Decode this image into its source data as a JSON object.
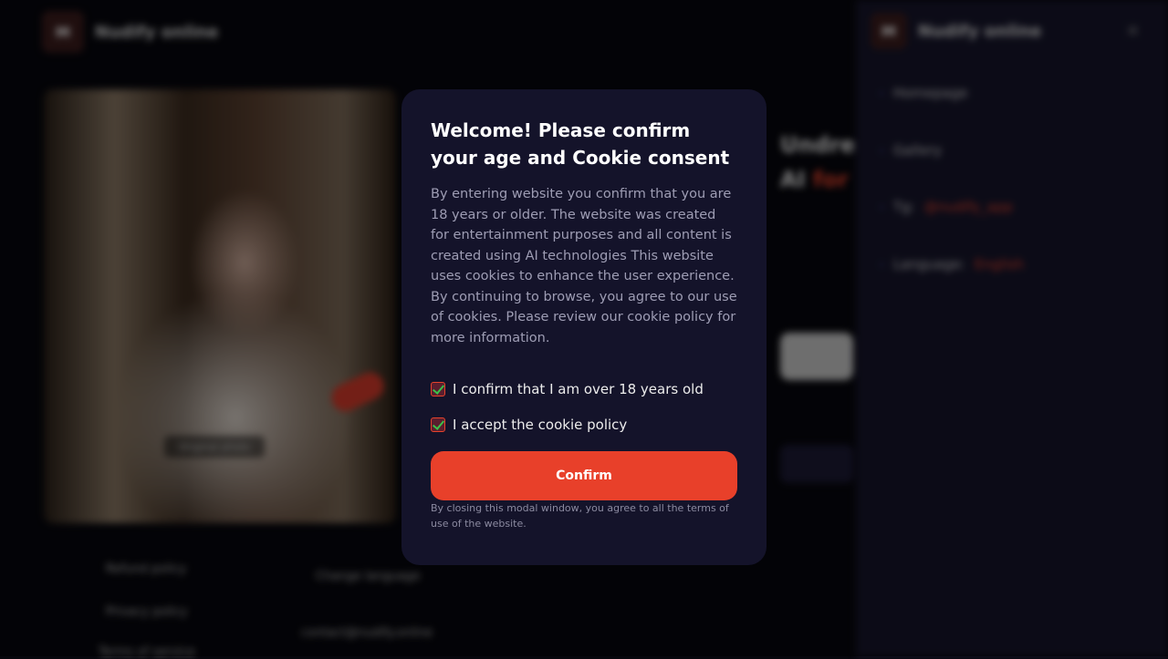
{
  "background": {
    "brand": "Nudify online",
    "logo_letter": "M",
    "image_caption": "Original photo",
    "hero_title_1": "Undre",
    "hero_title_2_plain": "AI ",
    "hero_title_2_accent": "for",
    "footer_links": [
      "Refund policy",
      "Privacy policy",
      "Terms of service",
      "Change language",
      "contact@nudify.online"
    ]
  },
  "sidebar": {
    "brand": "Nudify online",
    "logo_letter": "M",
    "items": [
      {
        "label": "Homepage",
        "accent": ""
      },
      {
        "label": "Gallery",
        "accent": ""
      },
      {
        "label": "Tg:",
        "accent": "@nudify_app"
      },
      {
        "label": "Language:",
        "accent": "English"
      }
    ]
  },
  "modal": {
    "title": "Welcome! Please confirm your age and Cookie consent",
    "body": "By entering website you confirm that you are 18 years or older. The website was created for entertainment purposes and all content is created using AI technologies This website uses cookies to enhance the user experience. By continuing to browse, you agree to our use of cookies. Please review our cookie policy for more information.",
    "checkbox_age": "I confirm that I am over 18 years old",
    "checkbox_cookie": "I accept the cookie policy",
    "age_checked": true,
    "cookie_checked": true,
    "confirm_label": "Confirm",
    "disclaimer": "By closing this modal window, you agree to all the terms of use of the website."
  },
  "colors": {
    "accent": "#e8402a",
    "modal_bg": "#14132a",
    "page_bg": "#07070d",
    "sidebar_bg": "#16152a"
  }
}
